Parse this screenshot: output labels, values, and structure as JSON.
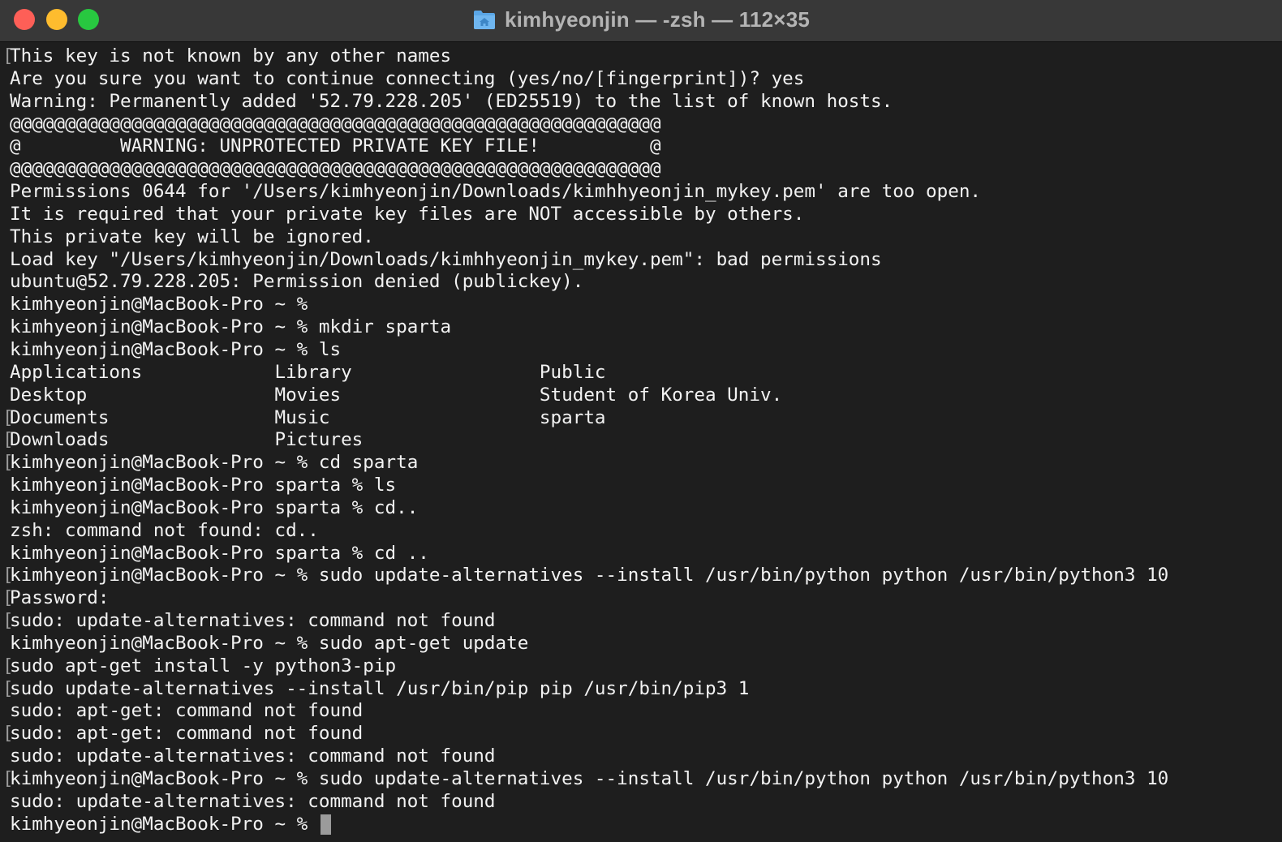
{
  "window": {
    "title": "kimhyeonjin — -zsh — 112×35",
    "title_icon": "home-folder-icon",
    "colors": {
      "close": "#fe5f57",
      "minimize": "#febc2e",
      "maximize": "#28c840",
      "background": "#1e1e1e",
      "text": "#f2f2f2"
    }
  },
  "terminal": {
    "lines": [
      {
        "text": "This key is not known by any other names",
        "marked": true
      },
      {
        "text": "Are you sure you want to continue connecting (yes/no/[fingerprint])? yes",
        "marked": false
      },
      {
        "text": "Warning: Permanently added '52.79.228.205' (ED25519) to the list of known hosts.",
        "marked": false
      },
      {
        "text": "@@@@@@@@@@@@@@@@@@@@@@@@@@@@@@@@@@@@@@@@@@@@@@@@@@@@@@@@@@@",
        "marked": false
      },
      {
        "text": "@         WARNING: UNPROTECTED PRIVATE KEY FILE!          @",
        "marked": false
      },
      {
        "text": "@@@@@@@@@@@@@@@@@@@@@@@@@@@@@@@@@@@@@@@@@@@@@@@@@@@@@@@@@@@",
        "marked": false
      },
      {
        "text": "Permissions 0644 for '/Users/kimhyeonjin/Downloads/kimhhyeonjin_mykey.pem' are too open.",
        "marked": false
      },
      {
        "text": "It is required that your private key files are NOT accessible by others.",
        "marked": false
      },
      {
        "text": "This private key will be ignored.",
        "marked": false
      },
      {
        "text": "Load key \"/Users/kimhyeonjin/Downloads/kimhhyeonjin_mykey.pem\": bad permissions",
        "marked": false
      },
      {
        "text": "ubuntu@52.79.228.205: Permission denied (publickey).",
        "marked": false
      },
      {
        "text": "kimhyeonjin@MacBook-Pro ~ %",
        "marked": false
      },
      {
        "text": "kimhyeonjin@MacBook-Pro ~ % mkdir sparta",
        "marked": false
      },
      {
        "text": "kimhyeonjin@MacBook-Pro ~ % ls",
        "marked": false
      },
      {
        "text": "Applications            Library                 Public",
        "marked": false
      },
      {
        "text": "Desktop                 Movies                  Student of Korea Univ.",
        "marked": false
      },
      {
        "text": "Documents               Music                   sparta",
        "marked": true
      },
      {
        "text": "Downloads               Pictures",
        "marked": true
      },
      {
        "text": "kimhyeonjin@MacBook-Pro ~ % cd sparta",
        "marked": true
      },
      {
        "text": "kimhyeonjin@MacBook-Pro sparta % ls",
        "marked": false
      },
      {
        "text": "kimhyeonjin@MacBook-Pro sparta % cd..",
        "marked": false
      },
      {
        "text": "zsh: command not found: cd..",
        "marked": false
      },
      {
        "text": "kimhyeonjin@MacBook-Pro sparta % cd ..",
        "marked": false
      },
      {
        "text": "kimhyeonjin@MacBook-Pro ~ % sudo update-alternatives --install /usr/bin/python python /usr/bin/python3 10",
        "marked": true
      },
      {
        "text": "Password:",
        "marked": true
      },
      {
        "text": "sudo: update-alternatives: command not found",
        "marked": true
      },
      {
        "text": "kimhyeonjin@MacBook-Pro ~ % sudo apt-get update",
        "marked": false
      },
      {
        "text": "sudo apt-get install -y python3-pip",
        "marked": true
      },
      {
        "text": "sudo update-alternatives --install /usr/bin/pip pip /usr/bin/pip3 1",
        "marked": true
      },
      {
        "text": "sudo: apt-get: command not found",
        "marked": false
      },
      {
        "text": "sudo: apt-get: command not found",
        "marked": true
      },
      {
        "text": "sudo: update-alternatives: command not found",
        "marked": false
      },
      {
        "text": "kimhyeonjin@MacBook-Pro ~ % sudo update-alternatives --install /usr/bin/python python /usr/bin/python3 10",
        "marked": true
      },
      {
        "text": "sudo: update-alternatives: command not found",
        "marked": false
      }
    ],
    "prompt": "kimhyeonjin@MacBook-Pro ~ % ",
    "mark_glyph": "["
  }
}
